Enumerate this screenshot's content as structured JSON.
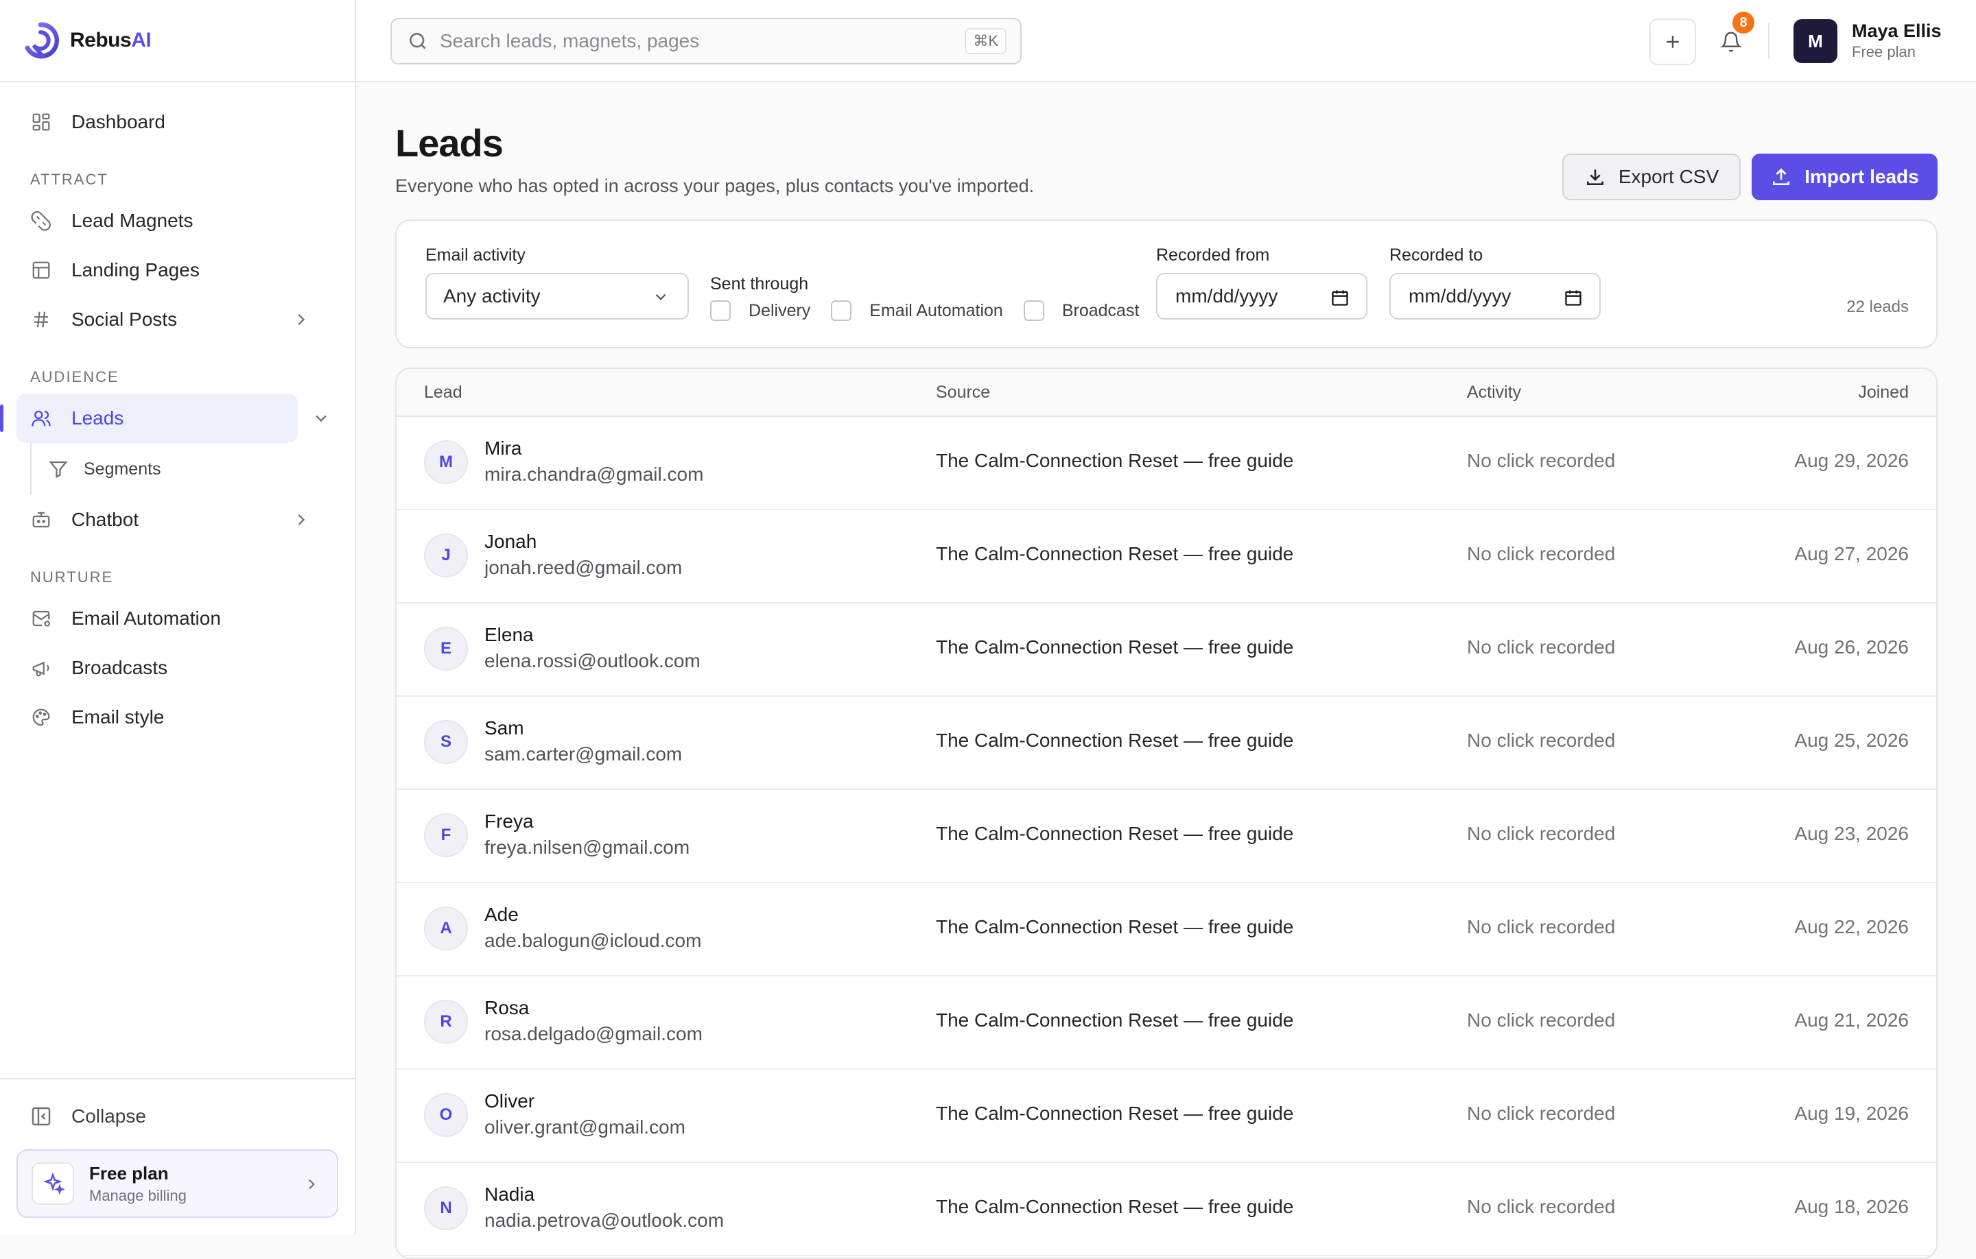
{
  "brand": {
    "name_prefix": "Rebus",
    "name_suffix": "AI"
  },
  "sidebar": {
    "dashboard": "Dashboard",
    "attract_label": "ATTRACT",
    "lead_magnets": "Lead Magnets",
    "landing_pages": "Landing Pages",
    "social_posts": "Social Posts",
    "audience_label": "AUDIENCE",
    "leads": "Leads",
    "segments": "Segments",
    "chatbot": "Chatbot",
    "nurture_label": "NURTURE",
    "email_automation": "Email Automation",
    "broadcasts": "Broadcasts",
    "email_style": "Email style",
    "collapse": "Collapse",
    "plan_title": "Free plan",
    "plan_sub": "Manage billing"
  },
  "topbar": {
    "search_placeholder": "Search leads, magnets, pages",
    "shortcut": "⌘K",
    "notification_count": "8",
    "user_initial": "M",
    "user_name": "Maya Ellis",
    "user_plan": "Free plan"
  },
  "page": {
    "title": "Leads",
    "subtitle": "Everyone who has opted in across your pages, plus contacts you've imported.",
    "export_label": "Export CSV",
    "import_label": "Import leads"
  },
  "filters": {
    "email_activity_label": "Email activity",
    "email_activity_value": "Any activity",
    "sent_through_label": "Sent through",
    "channels": [
      "Delivery",
      "Email Automation",
      "Broadcast"
    ],
    "recorded_from_label": "Recorded from",
    "recorded_from_value": "mm/dd/yyyy",
    "recorded_to_label": "Recorded to",
    "recorded_to_value": "mm/dd/yyyy",
    "lead_count": "22 leads"
  },
  "table": {
    "headers": {
      "lead": "Lead",
      "source": "Source",
      "activity": "Activity",
      "joined": "Joined"
    },
    "rows": [
      {
        "initial": "M",
        "name": "Mira",
        "email": "mira.chandra@gmail.com",
        "source": "The Calm-Connection Reset — free guide",
        "activity": "No click recorded",
        "joined": "Aug 29, 2026"
      },
      {
        "initial": "J",
        "name": "Jonah",
        "email": "jonah.reed@gmail.com",
        "source": "The Calm-Connection Reset — free guide",
        "activity": "No click recorded",
        "joined": "Aug 27, 2026"
      },
      {
        "initial": "E",
        "name": "Elena",
        "email": "elena.rossi@outlook.com",
        "source": "The Calm-Connection Reset — free guide",
        "activity": "No click recorded",
        "joined": "Aug 26, 2026"
      },
      {
        "initial": "S",
        "name": "Sam",
        "email": "sam.carter@gmail.com",
        "source": "The Calm-Connection Reset — free guide",
        "activity": "No click recorded",
        "joined": "Aug 25, 2026"
      },
      {
        "initial": "F",
        "name": "Freya",
        "email": "freya.nilsen@gmail.com",
        "source": "The Calm-Connection Reset — free guide",
        "activity": "No click recorded",
        "joined": "Aug 23, 2026"
      },
      {
        "initial": "A",
        "name": "Ade",
        "email": "ade.balogun@icloud.com",
        "source": "The Calm-Connection Reset — free guide",
        "activity": "No click recorded",
        "joined": "Aug 22, 2026"
      },
      {
        "initial": "R",
        "name": "Rosa",
        "email": "rosa.delgado@gmail.com",
        "source": "The Calm-Connection Reset — free guide",
        "activity": "No click recorded",
        "joined": "Aug 21, 2026"
      },
      {
        "initial": "O",
        "name": "Oliver",
        "email": "oliver.grant@gmail.com",
        "source": "The Calm-Connection Reset — free guide",
        "activity": "No click recorded",
        "joined": "Aug 19, 2026"
      },
      {
        "initial": "N",
        "name": "Nadia",
        "email": "nadia.petrova@outlook.com",
        "source": "The Calm-Connection Reset — free guide",
        "activity": "No click recorded",
        "joined": "Aug 18, 2026"
      }
    ]
  },
  "colors": {
    "accent": "#5b4ee6",
    "badge": "#f97316",
    "avatar_dark": "#1e1b3a"
  }
}
